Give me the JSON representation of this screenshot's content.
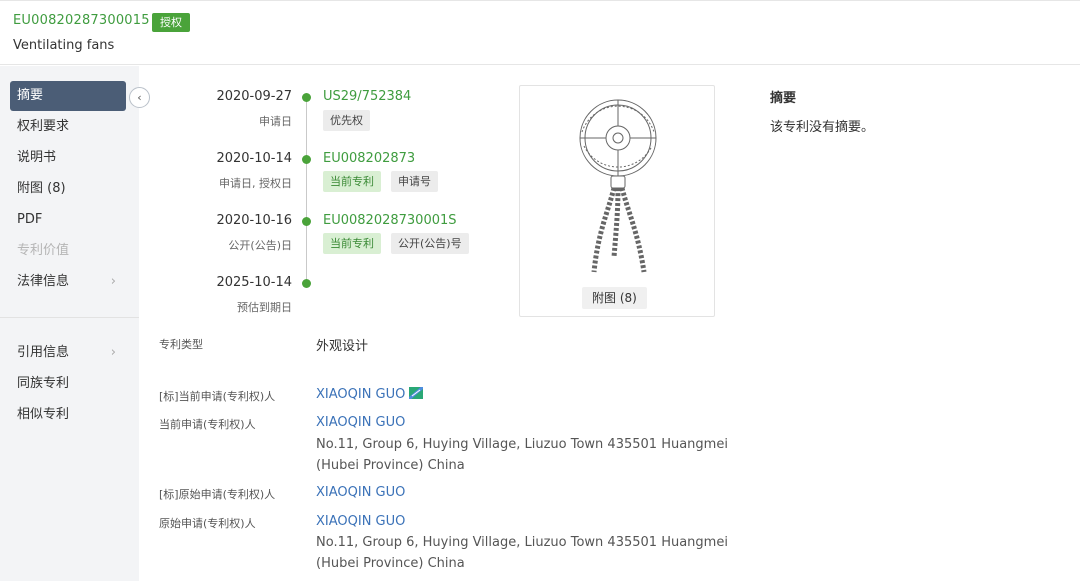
{
  "header": {
    "publication_number": "EU00820287300015",
    "status": "授权",
    "title": "Ventilating fans"
  },
  "sidebar": {
    "items": [
      {
        "label": "摘要"
      },
      {
        "label": "权利要求"
      },
      {
        "label": "说明书"
      },
      {
        "label": "附图 (8)"
      },
      {
        "label": "PDF"
      },
      {
        "label": "专利价值"
      },
      {
        "label": "法律信息"
      },
      {
        "label": "引用信息"
      },
      {
        "label": "同族专利"
      },
      {
        "label": "相似专利"
      }
    ],
    "chevron": "›",
    "collapse_icon": "‹"
  },
  "timeline": [
    {
      "date": "2020-09-27",
      "label": "申请日",
      "link": "US29/752384",
      "tags": [
        "优先权"
      ]
    },
    {
      "date": "2020-10-14",
      "label": "申请日, 授权日",
      "link": "EU008202873",
      "tags": [
        "当前专利",
        "申请号"
      ]
    },
    {
      "date": "2020-10-16",
      "label": "公开(公告)日",
      "link": "EU0082028730001S",
      "tags": [
        "当前专利",
        "公开(公告)号"
      ]
    },
    {
      "date": "2025-10-14",
      "label": "预估到期日"
    }
  ],
  "figure": {
    "caption": "附图 (8)",
    "icon": "fan-drawing"
  },
  "abstract": {
    "title": "摘要",
    "text": "该专利没有摘要。"
  },
  "info": {
    "patent_type_label": "专利类型",
    "patent_type_value": "外观设计",
    "std_current_applicant_label": "[标]当前申请(专利权)人",
    "std_current_applicant_value": "XIAOQIN GUO",
    "current_applicant_label": "当前申请(专利权)人",
    "current_applicant_value": "XIAOQIN GUO",
    "current_applicant_addr1": "No.11, Group 6, Huying Village, Liuzuo Town 435501 Huangmei",
    "current_applicant_addr2": "(Hubei Province) China",
    "std_original_applicant_label": "[标]原始申请(专利权)人",
    "std_original_applicant_value": "XIAOQIN GUO",
    "original_applicant_label": "原始申请(专利权)人",
    "original_applicant_value": "XIAOQIN GUO",
    "original_applicant_addr1": "No.11, Group 6, Huying Village, Liuzuo Town 435501 Huangmei",
    "original_applicant_addr2": "(Hubei Province) China"
  },
  "colors": {
    "accent_green": "#4aa33a",
    "link_blue": "#3b72b8",
    "sidebar_active": "#4b5d76"
  }
}
